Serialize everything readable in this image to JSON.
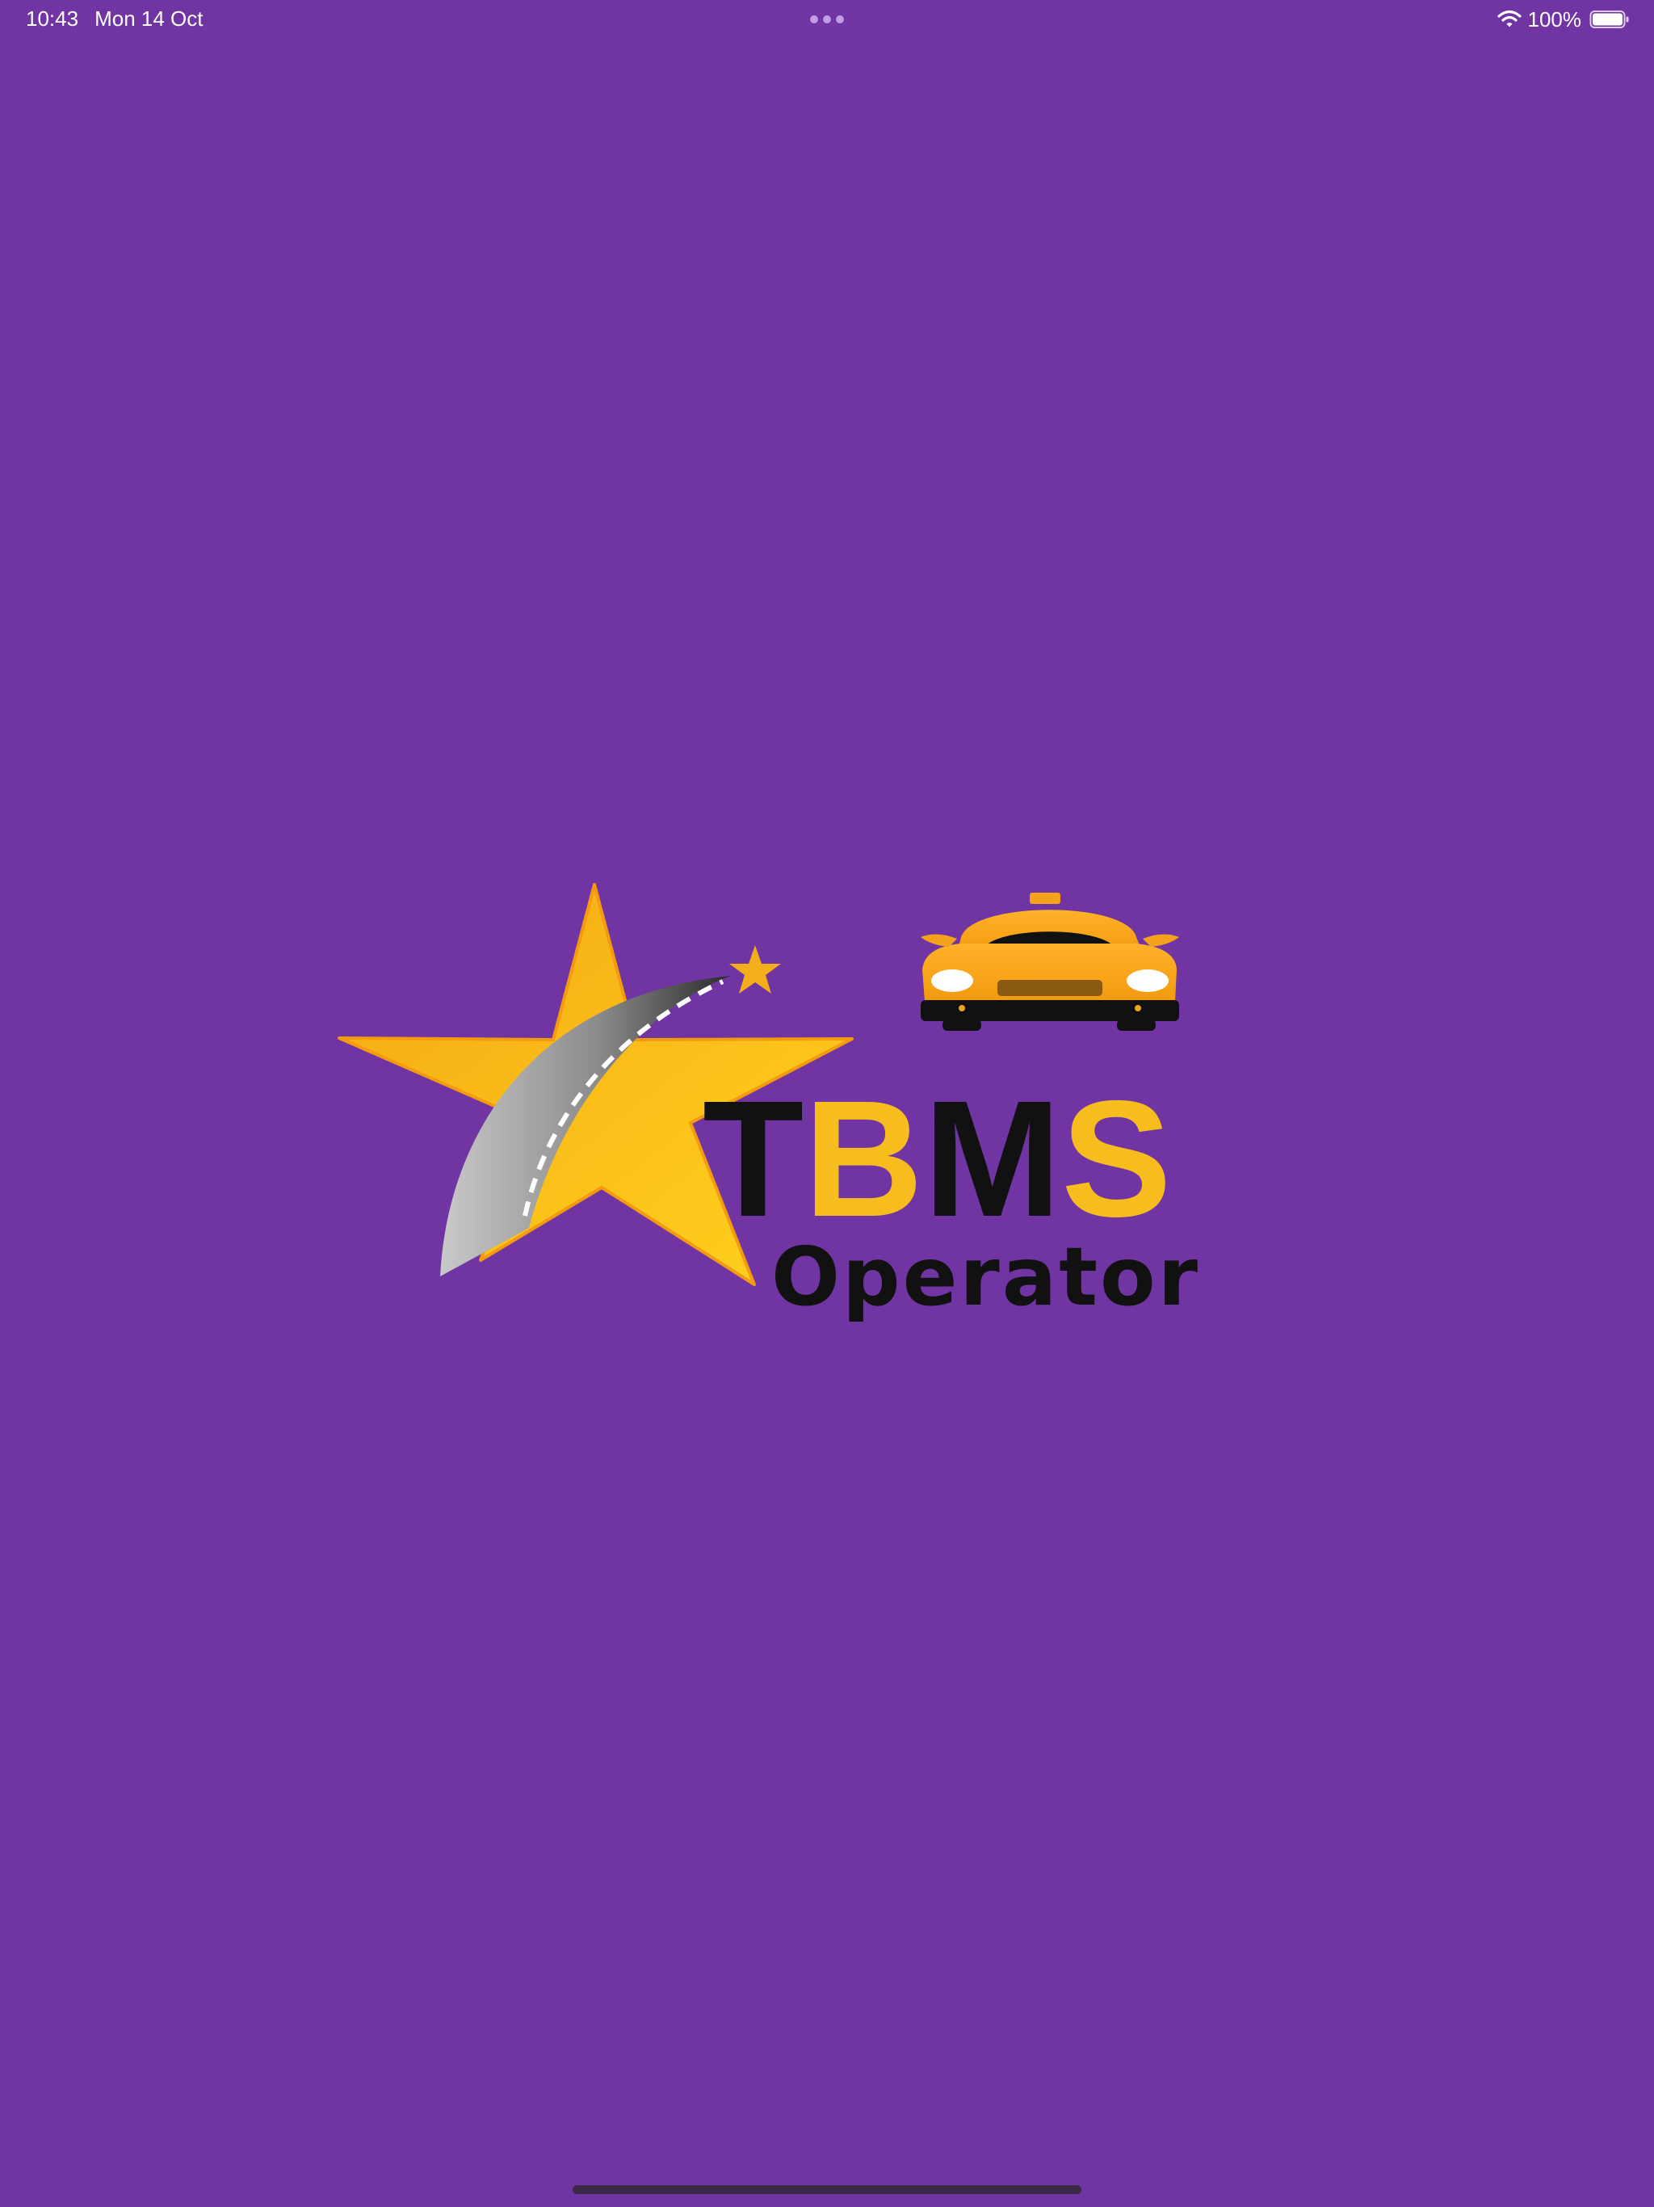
{
  "status_bar": {
    "time": "10:43",
    "date": "Mon 14 Oct",
    "battery_percent": "100%",
    "battery_level": 1.0,
    "icons": [
      "wifi-icon",
      "battery-icon",
      "multitask-dots-icon"
    ]
  },
  "splash": {
    "logo": {
      "wordmark": "TBMS",
      "subtitle": "Operator"
    }
  },
  "colors": {
    "background": "#7035A2",
    "logo_yellow": "#F7BC1E",
    "logo_black": "#111111",
    "road_grey": "#9a9a9a"
  }
}
